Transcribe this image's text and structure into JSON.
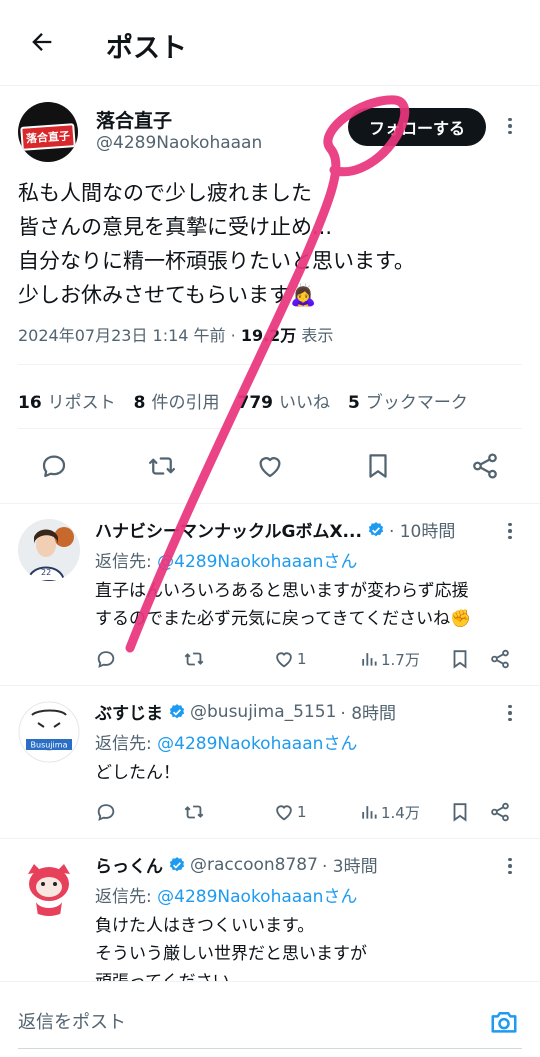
{
  "header": {
    "title": "ポスト",
    "back": "back-arrow-icon"
  },
  "post": {
    "author_name": "落合直子",
    "author_handle": "@4289Naokohaaan",
    "avatar_text": "落合直子",
    "follow_label": "フォローする",
    "lines": [
      "私も人間なので少し疲れました",
      "皆さんの意見を真摯に受け止め...",
      "自分なりに精一杯頑張りたいと思います。",
      "少しお休みさせてもらいます🙇‍♀️"
    ],
    "time": "2024年07月23日 1:14 午前",
    "dot": "·",
    "views_count": "19.2万",
    "views_label": "表示",
    "stats": [
      {
        "count": "16",
        "label": "リポスト"
      },
      {
        "count": "8",
        "label": "件の引用"
      },
      {
        "count": "779",
        "label": "いいね"
      },
      {
        "count": "5",
        "label": "ブックマーク"
      }
    ]
  },
  "replies": [
    {
      "name": "ハナビシーマンナックルGボムX...",
      "verified": true,
      "handle": "",
      "time": "· 10時間",
      "to_prefix": "返信先: ",
      "to_link": "@4289Naokohaaanさん",
      "lines": [
        "直子はんいろいろあると思いますが変わらず応援",
        "するのでまた必ず元気に戻ってきてくださいね✊"
      ],
      "likes": "1",
      "views": "1.7万"
    },
    {
      "name": "ぶすじま",
      "verified": true,
      "handle": "@busujima_5151",
      "time": "· 8時間",
      "to_prefix": "返信先: ",
      "to_link": "@4289Naokohaaanさん",
      "lines": [
        "どしたん！"
      ],
      "avatar_text": "Busujima",
      "likes": "1",
      "views": "1.4万"
    },
    {
      "name": "らっくん",
      "verified": true,
      "handle": "@raccoon8787",
      "time": "· 3時間",
      "to_prefix": "返信先: ",
      "to_link": "@4289Naokohaaanさん",
      "lines": [
        "負けた人はきつくいいます。",
        "そういう厳しい世界だと思いますが",
        "頑張ってください"
      ]
    }
  ],
  "compose": {
    "placeholder": "返信をポスト",
    "camera": "camera-icon"
  },
  "colors": {
    "link": "#1d9bf0",
    "muted": "#536471",
    "text": "#0f1419",
    "annotation": "#e8357d"
  }
}
